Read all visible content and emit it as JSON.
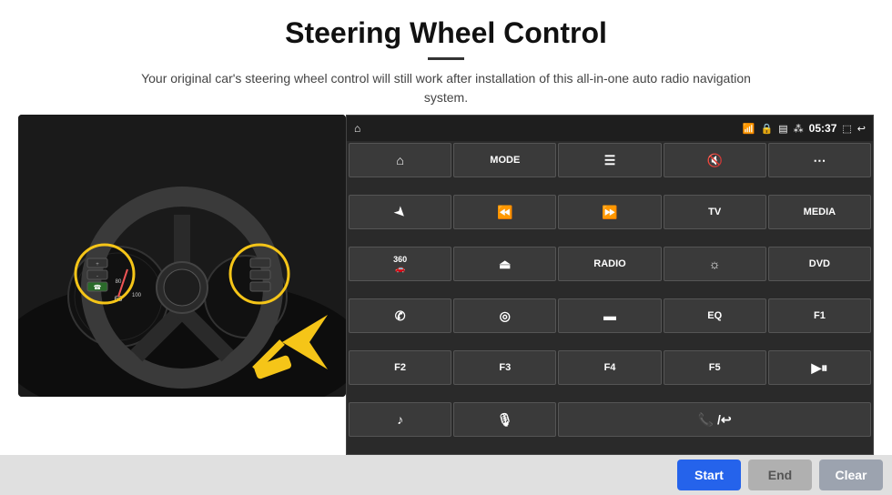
{
  "header": {
    "title": "Steering Wheel Control",
    "subtitle": "Your original car's steering wheel control will still work after installation of this all-in-one auto radio navigation system."
  },
  "status_bar": {
    "time": "05:37",
    "icons": [
      "wifi",
      "lock",
      "sim",
      "bluetooth",
      "battery",
      "cast",
      "back"
    ]
  },
  "control_buttons": [
    {
      "id": "nav",
      "icon": "⌂",
      "label": ""
    },
    {
      "id": "mode",
      "icon": "",
      "label": "MODE"
    },
    {
      "id": "menu",
      "icon": "☰",
      "label": ""
    },
    {
      "id": "mute",
      "icon": "🔇",
      "label": ""
    },
    {
      "id": "apps",
      "icon": "⋯",
      "label": ""
    },
    {
      "id": "send",
      "icon": "➤",
      "label": ""
    },
    {
      "id": "prev",
      "icon": "⏮",
      "label": ""
    },
    {
      "id": "next",
      "icon": "⏭",
      "label": ""
    },
    {
      "id": "tv",
      "icon": "",
      "label": "TV"
    },
    {
      "id": "media",
      "icon": "",
      "label": "MEDIA"
    },
    {
      "id": "cam360",
      "icon": "⊛",
      "label": "360"
    },
    {
      "id": "eject",
      "icon": "⏏",
      "label": ""
    },
    {
      "id": "radio",
      "icon": "",
      "label": "RADIO"
    },
    {
      "id": "brightness",
      "icon": "☼",
      "label": ""
    },
    {
      "id": "dvd",
      "icon": "",
      "label": "DVD"
    },
    {
      "id": "phone",
      "icon": "✆",
      "label": ""
    },
    {
      "id": "browse",
      "icon": "◎",
      "label": ""
    },
    {
      "id": "screen",
      "icon": "▬",
      "label": ""
    },
    {
      "id": "eq",
      "icon": "",
      "label": "EQ"
    },
    {
      "id": "f1",
      "icon": "",
      "label": "F1"
    },
    {
      "id": "f2",
      "icon": "",
      "label": "F2"
    },
    {
      "id": "f3",
      "icon": "",
      "label": "F3"
    },
    {
      "id": "f4",
      "icon": "",
      "label": "F4"
    },
    {
      "id": "f5",
      "icon": "",
      "label": "F5"
    },
    {
      "id": "playpause",
      "icon": "▶⏸",
      "label": ""
    },
    {
      "id": "music",
      "icon": "♪",
      "label": ""
    },
    {
      "id": "mic",
      "icon": "🎙",
      "label": ""
    },
    {
      "id": "call",
      "icon": "📞/↩",
      "label": ""
    }
  ],
  "bottom_bar": {
    "start_label": "Start",
    "end_label": "End",
    "clear_label": "Clear"
  }
}
